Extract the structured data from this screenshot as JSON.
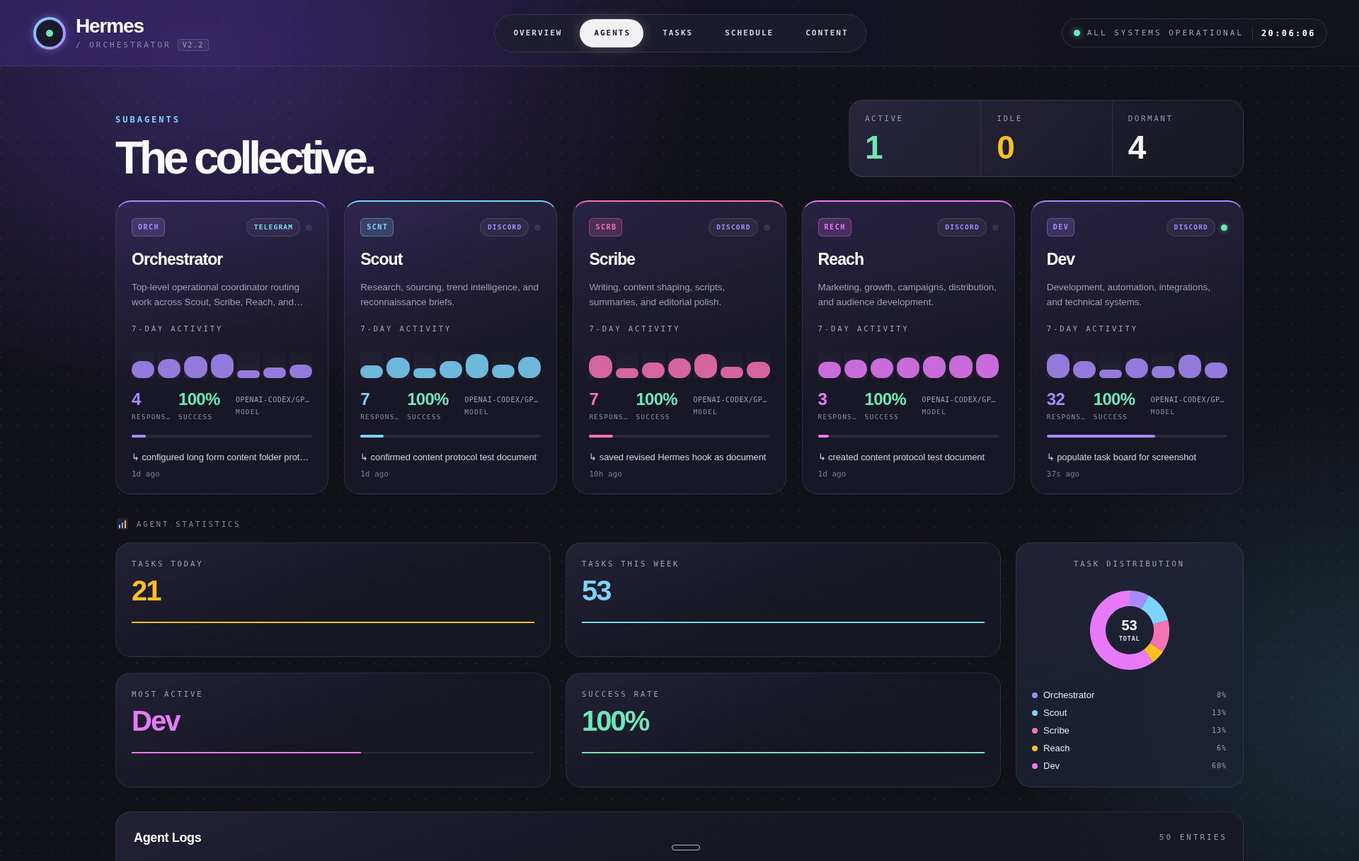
{
  "header": {
    "brand": {
      "name": "Hermes",
      "subtitle": "/ ORCHESTRATOR",
      "version": "V2.2"
    },
    "nav": [
      {
        "label": "OVERVIEW",
        "selected": false
      },
      {
        "label": "AGENTS",
        "selected": true
      },
      {
        "label": "TASKS",
        "selected": false
      },
      {
        "label": "SCHEDULE",
        "selected": false
      },
      {
        "label": "CONTENT",
        "selected": false
      }
    ],
    "status": {
      "label": "ALL SYSTEMS OPERATIONAL",
      "online": true,
      "time": "20:06:06"
    }
  },
  "hero": {
    "eyebrow": "SUBAGENTS",
    "title": "The collective.",
    "counts": [
      {
        "label": "ACTIVE",
        "value": "1",
        "color": "#6ee7b7"
      },
      {
        "label": "IDLE",
        "value": "0",
        "color": "#fbbf24"
      },
      {
        "label": "DORMANT",
        "value": "4",
        "color": "#f4f4f5"
      }
    ]
  },
  "agents": [
    {
      "code": "ORCH",
      "channel": {
        "label": "TELEGRAM",
        "color": "#7dd3fc"
      },
      "online": false,
      "name": "Orchestrator",
      "color": "#a78bfa",
      "description": "Top-level operational coordinator routing work across Scout, Scribe, Reach, and…",
      "activity_label": "7-DAY ACTIVITY",
      "activity": [
        {
          "level": 0.62
        },
        {
          "level": 0.71
        },
        {
          "level": 0.82
        },
        {
          "level": 0.9
        },
        {
          "level": 0.3
        },
        {
          "level": 0.39
        },
        {
          "level": 0.5
        }
      ],
      "stats": [
        {
          "kind": "count",
          "value": "4",
          "label": "RESPONS…"
        },
        {
          "kind": "rate",
          "value": "100%",
          "label": "SUCCESS"
        },
        {
          "kind": "model",
          "value": "OPENAI-CODEX/GP…",
          "label": "MODEL"
        }
      ],
      "level": 0.08,
      "last_action": "↳ configured long form content folder prot…",
      "time": "1d ago"
    },
    {
      "code": "SCNT",
      "channel": {
        "label": "DISCORD",
        "color": "#a78bfa"
      },
      "online": false,
      "name": "Scout",
      "color": "#7dd3fc",
      "description": "Research, sourcing, trend intelligence, and reconnaissance briefs.",
      "activity_label": "7-DAY ACTIVITY",
      "activity": [
        {
          "level": 0.47
        },
        {
          "level": 0.76
        },
        {
          "level": 0.36
        },
        {
          "level": 0.62
        },
        {
          "level": 0.9
        },
        {
          "level": 0.5
        },
        {
          "level": 0.79
        }
      ],
      "stats": [
        {
          "kind": "count",
          "value": "7",
          "label": "RESPONS…"
        },
        {
          "kind": "rate",
          "value": "100%",
          "label": "SUCCESS"
        },
        {
          "kind": "model",
          "value": "OPENAI-CODEX/GP…",
          "label": "MODEL"
        }
      ],
      "level": 0.13,
      "last_action": "↳ confirmed content protocol test document",
      "time": "1d ago"
    },
    {
      "code": "SCRB",
      "channel": {
        "label": "DISCORD",
        "color": "#a78bfa"
      },
      "online": false,
      "name": "Scribe",
      "color": "#f472b6",
      "description": "Writing, content shaping, scripts, summaries, and editorial polish.",
      "activity_label": "7-DAY ACTIVITY",
      "activity": [
        {
          "level": 0.84
        },
        {
          "level": 0.36
        },
        {
          "level": 0.57
        },
        {
          "level": 0.73
        },
        {
          "level": 0.9
        },
        {
          "level": 0.42
        },
        {
          "level": 0.6
        }
      ],
      "stats": [
        {
          "kind": "count",
          "value": "7",
          "label": "RESPONS…"
        },
        {
          "kind": "rate",
          "value": "100%",
          "label": "SUCCESS"
        },
        {
          "kind": "model",
          "value": "OPENAI-CODEX/GP…",
          "label": "MODEL"
        }
      ],
      "level": 0.13,
      "last_action": "↳ saved revised Hermes hook as document",
      "time": "10h ago"
    },
    {
      "code": "RECH",
      "channel": {
        "label": "DISCORD",
        "color": "#a78bfa"
      },
      "online": false,
      "name": "Reach",
      "color": "#e879f9",
      "description": "Marketing, growth, campaigns, distribution, and audience development.",
      "activity_label": "7-DAY ACTIVITY",
      "activity": [
        {
          "level": 0.61
        },
        {
          "level": 0.68
        },
        {
          "level": 0.74
        },
        {
          "level": 0.76
        },
        {
          "level": 0.82
        },
        {
          "level": 0.84
        },
        {
          "level": 0.89
        }
      ],
      "stats": [
        {
          "kind": "count",
          "value": "3",
          "label": "RESPONS…"
        },
        {
          "kind": "rate",
          "value": "100%",
          "label": "SUCCESS"
        },
        {
          "kind": "model",
          "value": "OPENAI-CODEX/GP…",
          "label": "MODEL"
        }
      ],
      "level": 0.06,
      "last_action": "↳ created content protocol test document",
      "time": "1d ago"
    },
    {
      "code": "DEV",
      "channel": {
        "label": "DISCORD",
        "color": "#a78bfa"
      },
      "online": true,
      "name": "Dev",
      "color": "#a78bfa",
      "description": "Development, automation, integrations, and technical systems.",
      "activity_label": "7-DAY ACTIVITY",
      "activity": [
        {
          "level": 0.89
        },
        {
          "level": 0.63
        },
        {
          "level": 0.32
        },
        {
          "level": 0.74
        },
        {
          "level": 0.45
        },
        {
          "level": 0.87
        },
        {
          "level": 0.58
        }
      ],
      "stats": [
        {
          "kind": "count",
          "value": "32",
          "label": "RESPONS…"
        },
        {
          "kind": "rate",
          "value": "100%",
          "label": "SUCCESS"
        },
        {
          "kind": "model",
          "value": "OPENAI-CODEX/GP…",
          "label": "MODEL"
        }
      ],
      "level": 0.6,
      "last_action": "↳ populate task board for screenshot",
      "time": "37s ago"
    }
  ],
  "statistics": {
    "title": "AGENT STATISTICS",
    "cards": [
      {
        "label": "TASKS TODAY",
        "value": "21",
        "color": "#fbbf24",
        "level": 1
      },
      {
        "label": "TASKS THIS WEEK",
        "value": "53",
        "color": "#7dd3fc",
        "level": 1
      },
      {
        "label": "MOST ACTIVE",
        "value": "Dev",
        "color": "#e879f9",
        "level": 0.57
      },
      {
        "label": "SUCCESS RATE",
        "value": "100%",
        "color": "#6ee7b7",
        "level": 1
      }
    ],
    "task_distribution": {
      "title": "TASK DISTRIBUTION",
      "chart_data": {
        "type": "donut",
        "categories": [
          "Orchestrator",
          "Scout",
          "Scribe",
          "Reach",
          "Dev"
        ],
        "values": [
          8,
          13,
          13,
          6,
          60
        ]
      },
      "total_value": "53",
      "total_label": "TOTAL",
      "legend": [
        {
          "percent": "8%",
          "color": "#a78bfa"
        },
        {
          "percent": "13%",
          "color": "#7dd3fc"
        },
        {
          "percent": "13%",
          "color": "#f472b6"
        },
        {
          "percent": "6%",
          "color": "#fbbf24"
        },
        {
          "percent": "60%",
          "color": "#e879f9"
        }
      ]
    }
  },
  "logs": {
    "title": "Agent Logs",
    "count": "50 ENTRIES"
  }
}
